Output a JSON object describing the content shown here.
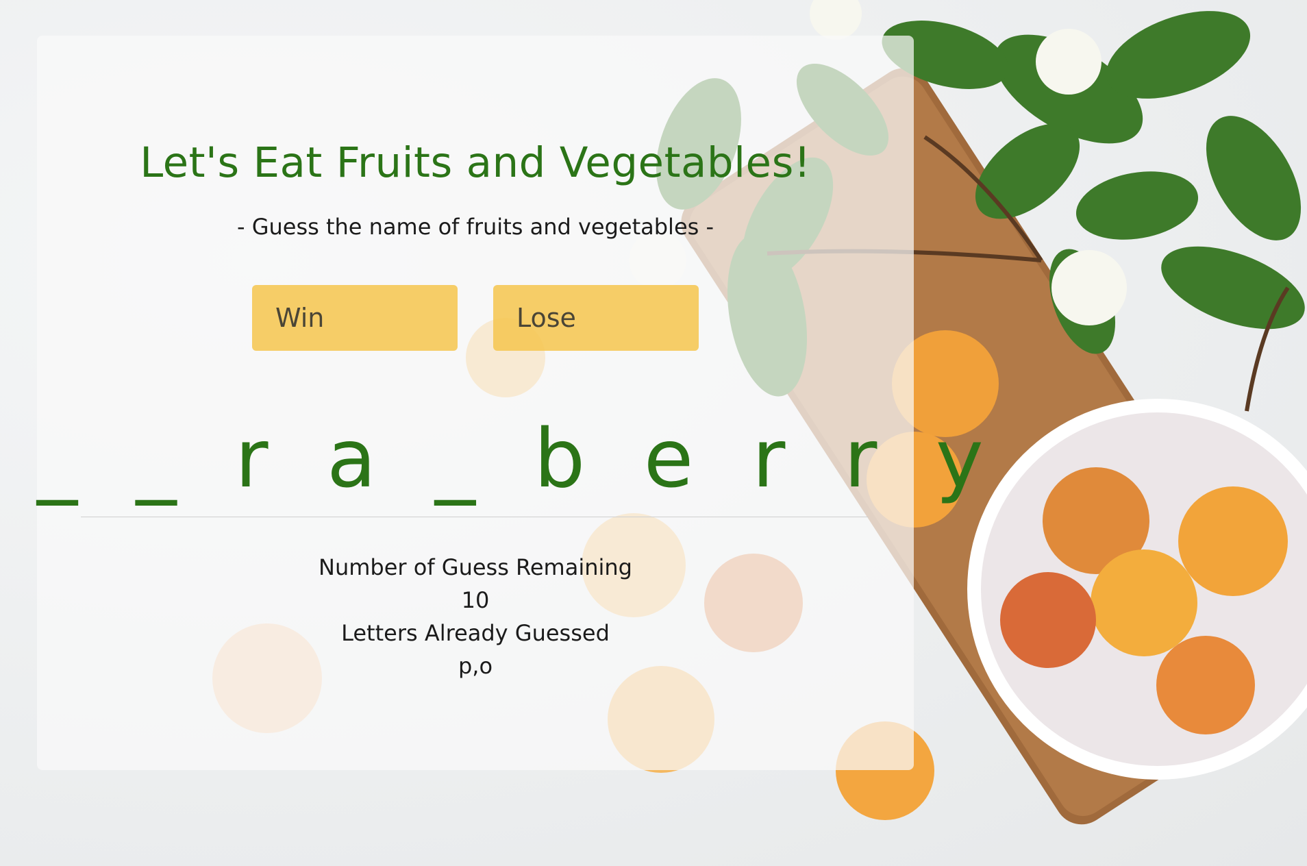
{
  "game": {
    "title": "Let's Eat Fruits and Vegetables!",
    "subtitle": "- Guess the name of fruits and vegetables -",
    "win_label": "Win",
    "lose_label": "Lose",
    "word_display": "_ _ r a _ b e r r y",
    "guesses_remaining_label": "Number of Guess Remaining",
    "guesses_remaining_value": "10",
    "letters_guessed_label": "Letters Already Guessed",
    "letters_guessed_value": "p,o"
  },
  "colors": {
    "title_green": "#2b7417",
    "stat_box_yellow": "#f6c64e",
    "card_bg": "#fafafa",
    "text_dark": "#1b1b1b"
  }
}
